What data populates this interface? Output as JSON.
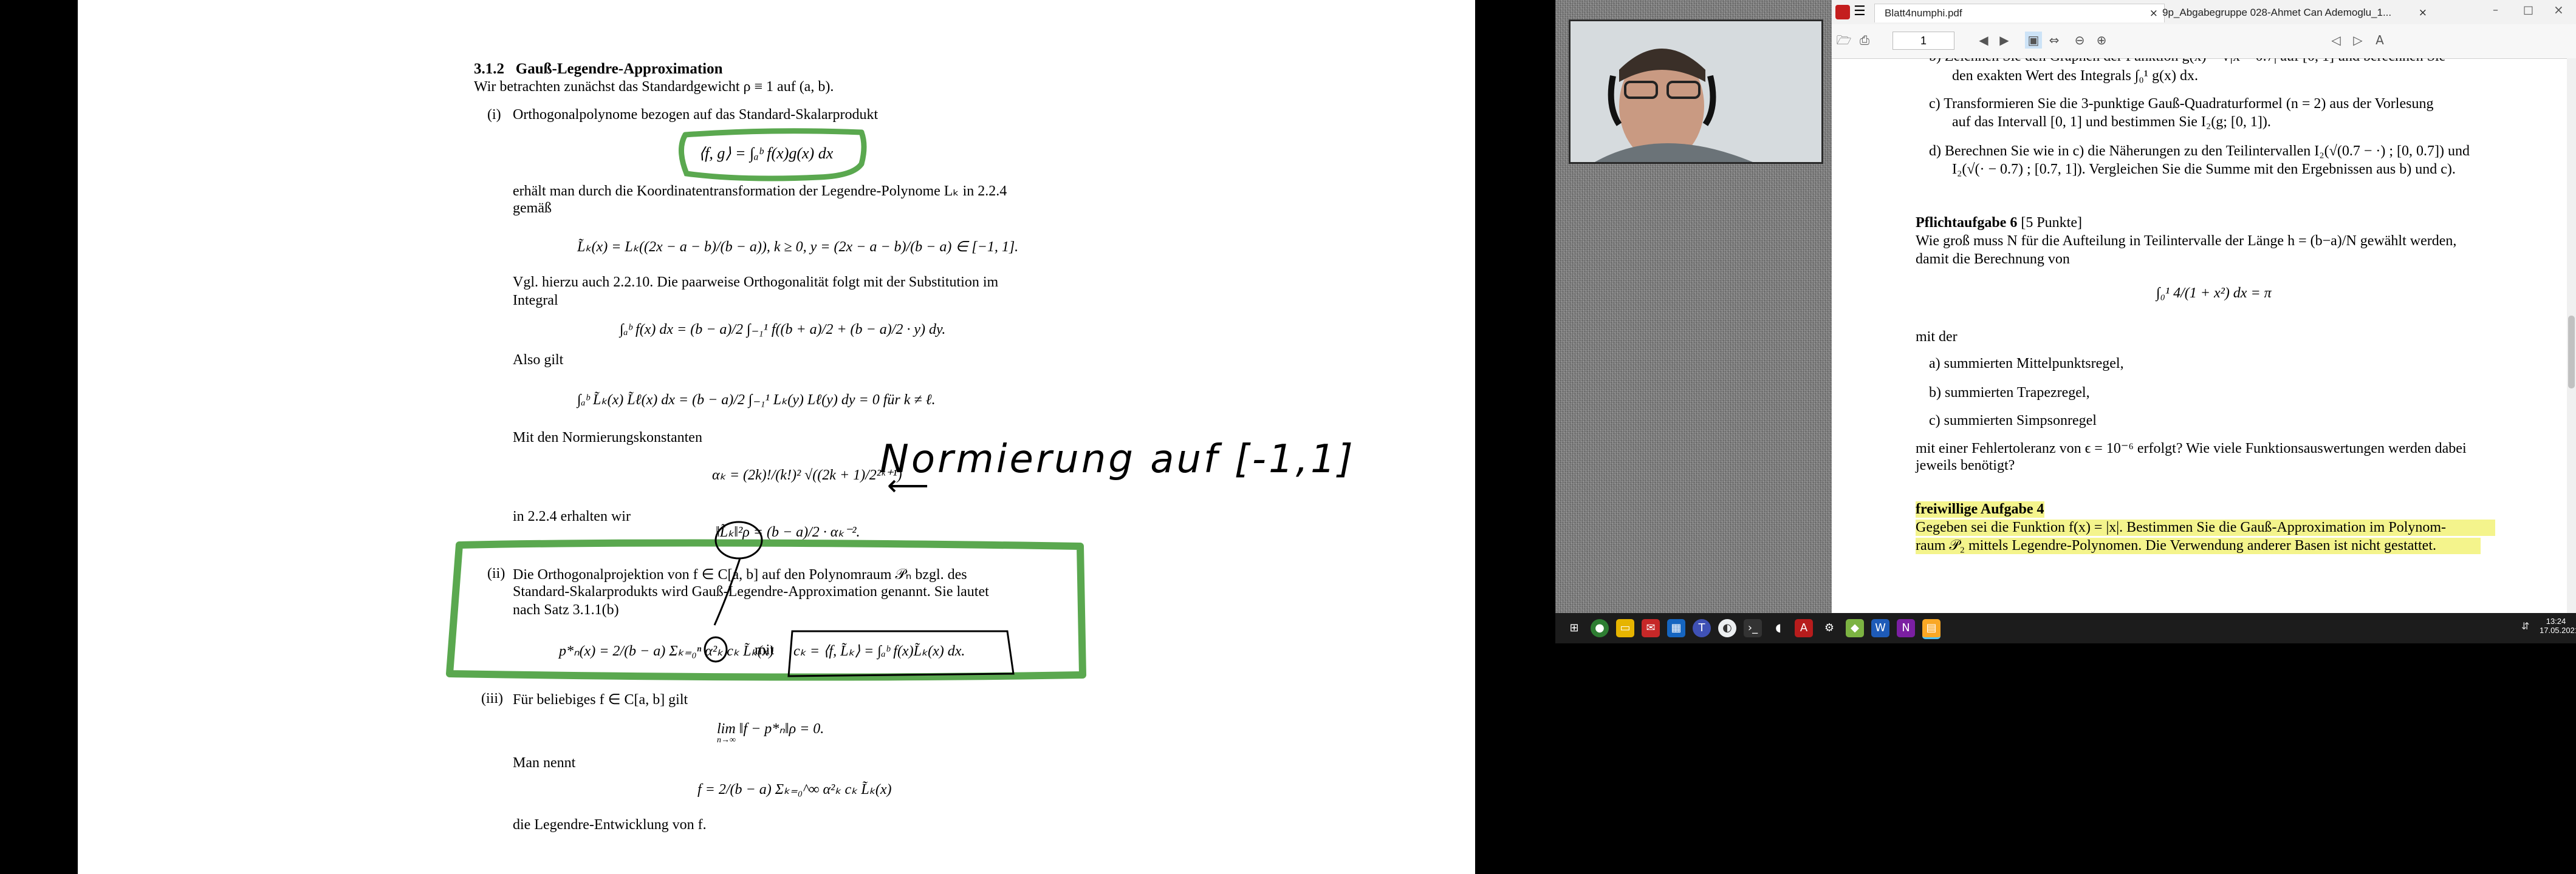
{
  "lecture": {
    "section_number": "3.1.2",
    "section_title": "Gauß-Legendre-Approximation",
    "intro": "Wir betrachten zunächst das Standardgewicht ρ ≡ 1 auf (a, b).",
    "item_i_label": "(i)",
    "item_i_text": "Orthogonalpolynome bezogen auf das Standard-Skalarprodukt",
    "inner_product": "⟨f, g⟩ = ∫ₐᵇ f(x)g(x) dx",
    "p2_line1": "erhält man durch die Koordinatentransformation der Legendre-Polynome Lₖ in 2.2.4",
    "p2_line2": "gemäß",
    "eq_transform": "L̃ₖ(x) = Lₖ((2x − a − b)/(b − a)),    k ≥ 0,    y = (2x − a − b)/(b − a) ∈ [−1, 1].",
    "p3_line1": "Vgl. hierzu auch 2.2.10. Die paarweise Orthogonalität folgt mit der Substitution im",
    "p3_line2": "Integral",
    "eq_subst": "∫ₐᵇ f(x) dx = (b − a)/2 ∫₋₁¹ f((b + a)/2 + (b − a)/2 · y) dy.",
    "also_gilt": "Also gilt",
    "eq_orth": "∫ₐᵇ L̃ₖ(x) L̃ℓ(x) dx = (b − a)/2 ∫₋₁¹ Lₖ(y) Lℓ(y) dy = 0   für   k ≠ ℓ.",
    "norm_intro": "Mit den Normierungskonstanten",
    "eq_alpha": "αₖ = (2k)!/(k!)² √((2k + 1)/2²ᵏ⁺¹)",
    "handwritten_note": "Normierung auf [-1,1]",
    "in_224": "in 2.2.4 erhalten wir",
    "eq_norm": "‖L̃ₖ‖²ρ = (b − a)/2 · αₖ⁻².",
    "item_ii_label": "(ii)",
    "item_ii_line1": "Die Orthogonalprojektion von f ∈ C[a, b] auf den Polynomraum 𝒫ₙ bzgl. des",
    "item_ii_line2": "Standard-Skalarprodukts wird Gauß-Legendre-Approximation genannt. Sie lautet",
    "item_ii_line3": "nach Satz 3.1.1(b)",
    "eq_proj": "p*ₙ(x) = 2/(b − a) Σₖ₌₀ⁿ α²ₖ cₖ L̃ₖ(x)",
    "mit": "mit",
    "eq_ck": "cₖ = ⟨f, L̃ₖ⟩ = ∫ₐᵇ f(x)L̃ₖ(x) dx.",
    "item_iii_label": "(iii)",
    "item_iii_text": "Für beliebiges f ∈ C[a, b] gilt",
    "eq_limit": "lim ‖f − p*ₙ‖ρ = 0.",
    "eq_limit_sub": "n→∞",
    "man_nennt": "Man nennt",
    "eq_series": "f = 2/(b − a) Σₖ₌₀^∞ α²ₖ cₖ L̃ₖ(x)",
    "legendre_end": "die Legendre-Entwicklung von f."
  },
  "pdf_viewer": {
    "tab_active": "Blatt4numphi.pdf",
    "tab_inactive": "9p_Abgabegruppe 028-Ahmet Can Ademoglu_1...",
    "page_number": "1",
    "task_b_line1": "b)  Zeichnen Sie den Graphen der Funktion g(x) = √|x − 0.7| auf [0, 1] und berechnen Sie",
    "task_b_line2": "den exakten Wert des Integrals ∫₀¹ g(x) dx.",
    "task_c_line1": "c)  Transformieren Sie die 3-punktige Gauß-Quadraturformel (n = 2) aus der Vorlesung",
    "task_c_line2": "auf das Intervall [0, 1] und bestimmen Sie I₂(g; [0, 1]).",
    "task_d_line1": "d)  Berechnen Sie wie in c) die Näherungen zu den Teilintervallen I₂(√(0.7 − ·) ; [0, 0.7]) und",
    "task_d_line2": "I₂(√(· − 0.7) ; [0.7, 1]). Vergleichen Sie die Summe mit den Ergebnissen aus b) und c).",
    "pflicht_title": "Pflichtaufgabe 6",
    "pflicht_points": "[5 Punkte]",
    "pflicht_line1": "Wie groß muss N für die Aufteilung in Teilintervalle der Länge h = (b−a)/N gewählt werden,",
    "pflicht_line2": "damit die Berechnung von",
    "pflicht_eq": "∫₀¹ 4/(1 + x²) dx = π",
    "mit_der": "mit der",
    "opt_a": "a)  summierten Mittelpunktsregel,",
    "opt_b": "b)  summierten Trapezregel,",
    "opt_c": "c)  summierten Simpsonregel",
    "tol_line1": "mit einer Fehlertoleranz von ϵ = 10⁻⁶ erfolgt? Wie viele Funktionsauswertungen werden dabei",
    "tol_line2": "jeweils benötigt?",
    "free_title": "freiwillige Aufgabe 4",
    "free_line1": "Gegeben sei die Funktion f(x) = |x|. Bestimmen Sie die Gauß-Approximation im Polynom-",
    "free_line2": "raum 𝒫₂ mittels Legendre-Polynomen. Die Verwendung anderer Basen ist nicht gestattet."
  },
  "taskbar": {
    "icons": [
      "windows-start-icon",
      "chrome-icon",
      "file-explorer-icon",
      "mail-icon",
      "calendar-icon",
      "teams-icon",
      "browser-icon",
      "terminal-icon",
      "app-icon",
      "acrobat-icon",
      "settings-icon",
      "app-green-icon",
      "word-icon",
      "onenote-icon",
      "pdf-app-icon"
    ],
    "time": "13:24",
    "date": "17.05.2021"
  },
  "colors": {
    "annotation_green": "#5aa84f",
    "highlight_yellow": "#f4f48c"
  }
}
